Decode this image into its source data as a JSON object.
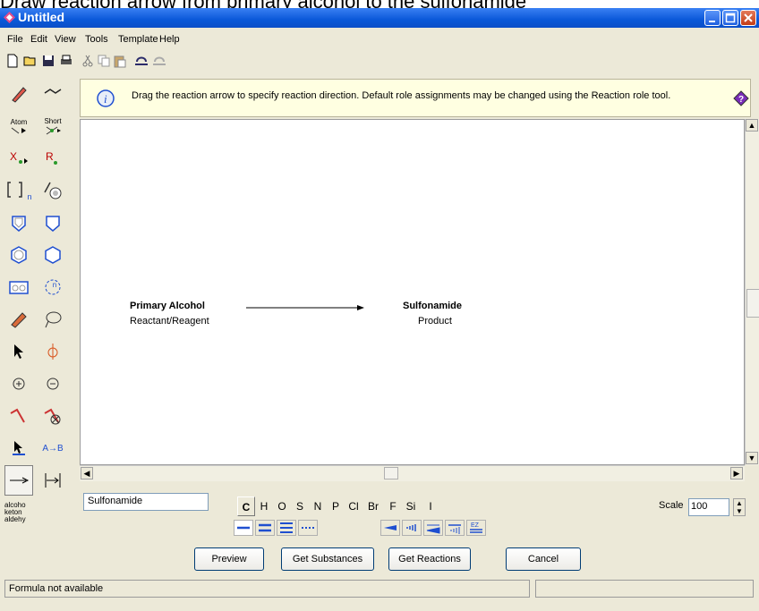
{
  "caption": "Draw reaction arrow from primary alcohol to the sulfonamide",
  "window": {
    "title": "Untitled"
  },
  "menu": [
    "File",
    "Edit",
    "View",
    "Tools",
    "Template",
    "Help"
  ],
  "palette": {
    "atom_label": "Atom",
    "short_label": "Short",
    "bracket_sub": "n",
    "ring_n": "n",
    "atob": "A→B",
    "fg_lines": [
      "alcoho",
      "keton",
      "aldehy"
    ]
  },
  "hint": {
    "text": "Drag the reaction arrow to specify reaction direction. Default role assignments may be changed using the Reaction role tool."
  },
  "reaction": {
    "reactant": {
      "name": "Primary Alcohol",
      "role": "Reactant/Reagent"
    },
    "product": {
      "name": "Sulfonamide",
      "role": "Product"
    }
  },
  "name_input": {
    "value": "Sulfonamide"
  },
  "elements": [
    "C",
    "H",
    "O",
    "S",
    "N",
    "P",
    "Cl",
    "Br",
    "F",
    "Si",
    "I"
  ],
  "selected_element": "C",
  "scale": {
    "label": "Scale",
    "value": "100"
  },
  "buttons": {
    "preview": "Preview",
    "get_substances": "Get Substances",
    "get_reactions": "Get Reactions",
    "cancel": "Cancel"
  },
  "status": {
    "text": "Formula not available"
  },
  "colors": {
    "title_bar": "#0a58d8",
    "hint_bg": "#ffffe1",
    "bond_blue": "#1f4fd0"
  }
}
